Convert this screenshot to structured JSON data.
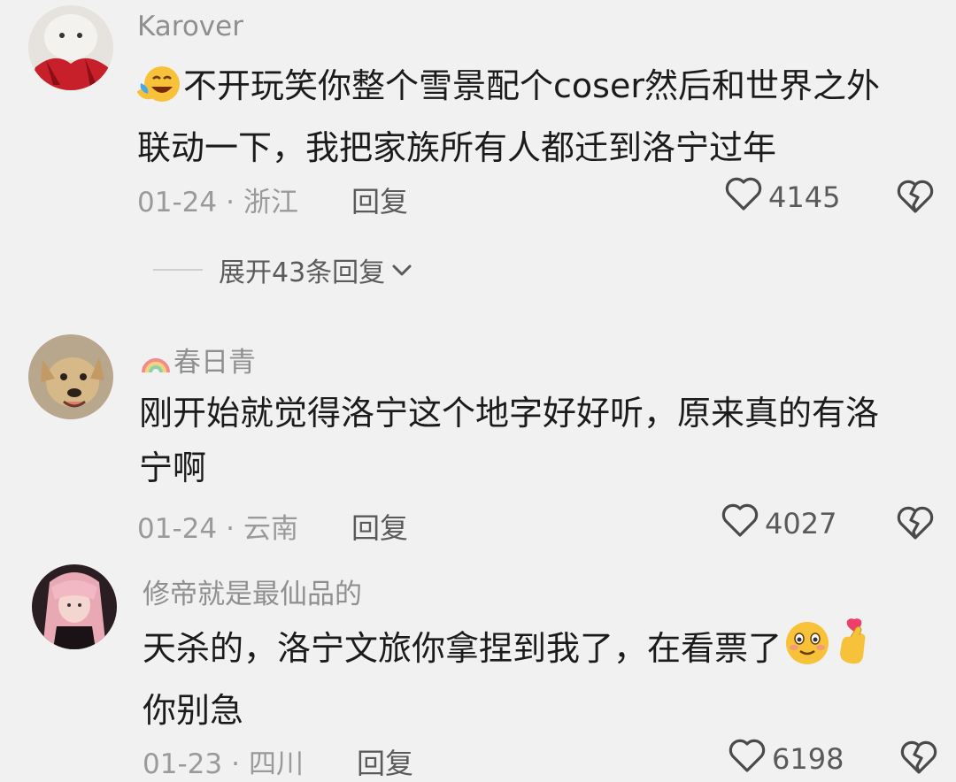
{
  "comments": [
    {
      "username": "Karover",
      "body_line1": "不开玩笑你整个雪景配个coser然后和世界之外",
      "body_line2": "联动一下，我把家族所有人都迁到洛宁过年",
      "date": "01-24",
      "location": "浙江",
      "reply_label": "回复",
      "likes": "4145",
      "leading_emoji": "laughing-tears-emoji"
    },
    {
      "username": "春日青",
      "username_prefix_icon": "rainbow-icon",
      "body_line1": "刚开始就觉得洛宁这个地字好好听，原来真的有洛",
      "body_line2": "宁啊",
      "date": "01-24",
      "location": "云南",
      "reply_label": "回复",
      "likes": "4027"
    },
    {
      "username": "修帝就是最仙品的",
      "body_line1": "天杀的，洛宁文旅你拿捏到我了，在看票了",
      "body_line2": "你别急",
      "date": "01-23",
      "location": "四川",
      "reply_label": "回复",
      "likes": "6198",
      "trailing_emojis": [
        "blush-smile-emoji",
        "finger-heart-emoji"
      ]
    }
  ],
  "expand_replies": {
    "label": "展开43条回复"
  },
  "colors": {
    "background": "#f1f1f1",
    "text": "#1b1b1b",
    "muted": "#9a9a9a"
  }
}
